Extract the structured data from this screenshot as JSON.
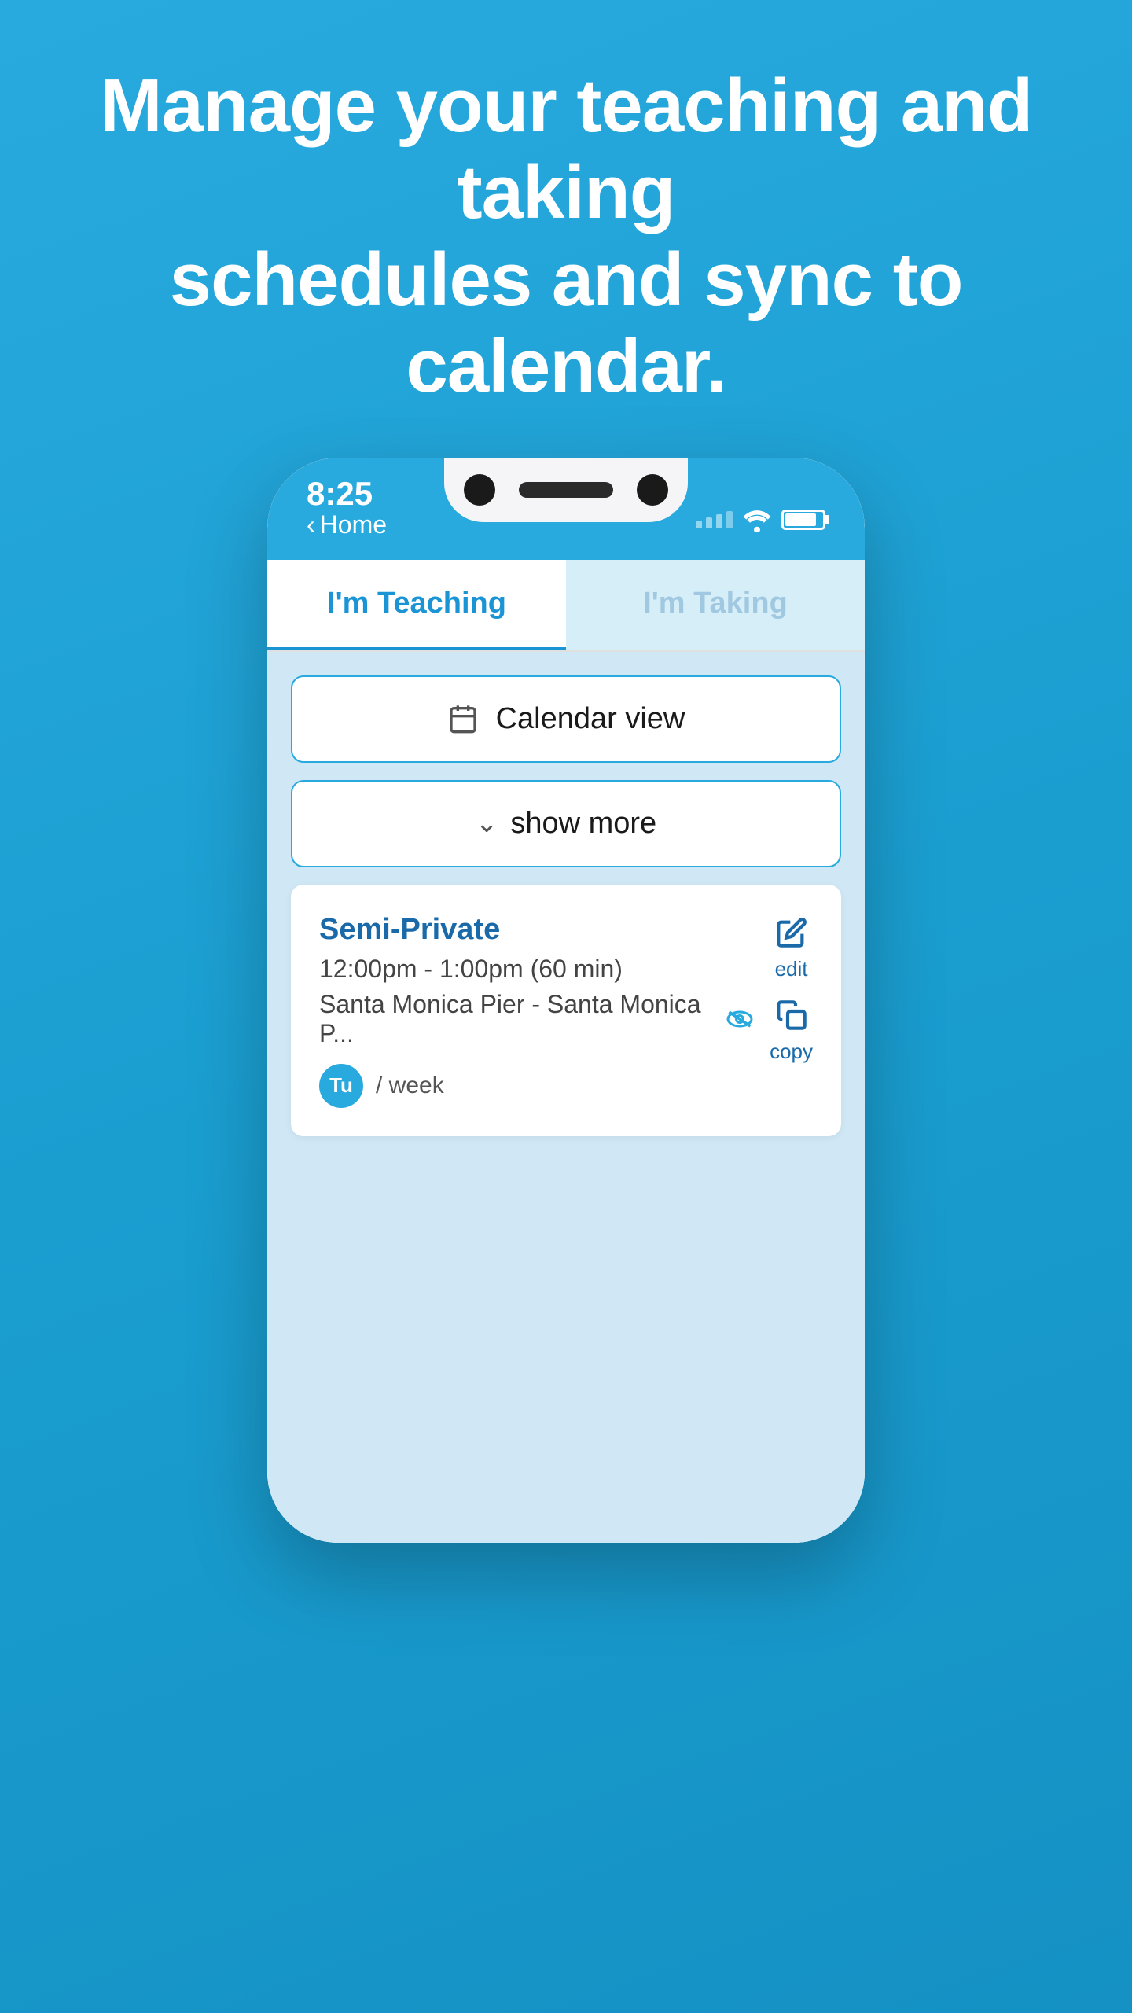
{
  "headline": {
    "line1": "Manage your teaching and taking",
    "line2": "schedules and sync to calendar."
  },
  "status_bar": {
    "time": "8:25",
    "back_label": "Home",
    "back_arrow": "‹"
  },
  "tabs": [
    {
      "id": "teaching",
      "label": "I'm Teaching",
      "active": true
    },
    {
      "id": "taking",
      "label": "I'm Taking",
      "active": false
    }
  ],
  "buttons": {
    "calendar_view": "Calendar view",
    "show_more": "show more"
  },
  "session": {
    "title": "Semi-Private",
    "time": "12:00pm - 1:00pm (60 min)",
    "location": "Santa Monica Pier - Santa Monica P...",
    "day_badge": "Tu",
    "frequency": "/ week",
    "actions": {
      "edit_label": "edit",
      "copy_label": "copy"
    }
  },
  "icons": {
    "calendar": "calendar-icon",
    "chevron_down": "chevron-down-icon",
    "edit": "edit-icon",
    "hide": "hide-icon",
    "copy": "copy-icon"
  }
}
